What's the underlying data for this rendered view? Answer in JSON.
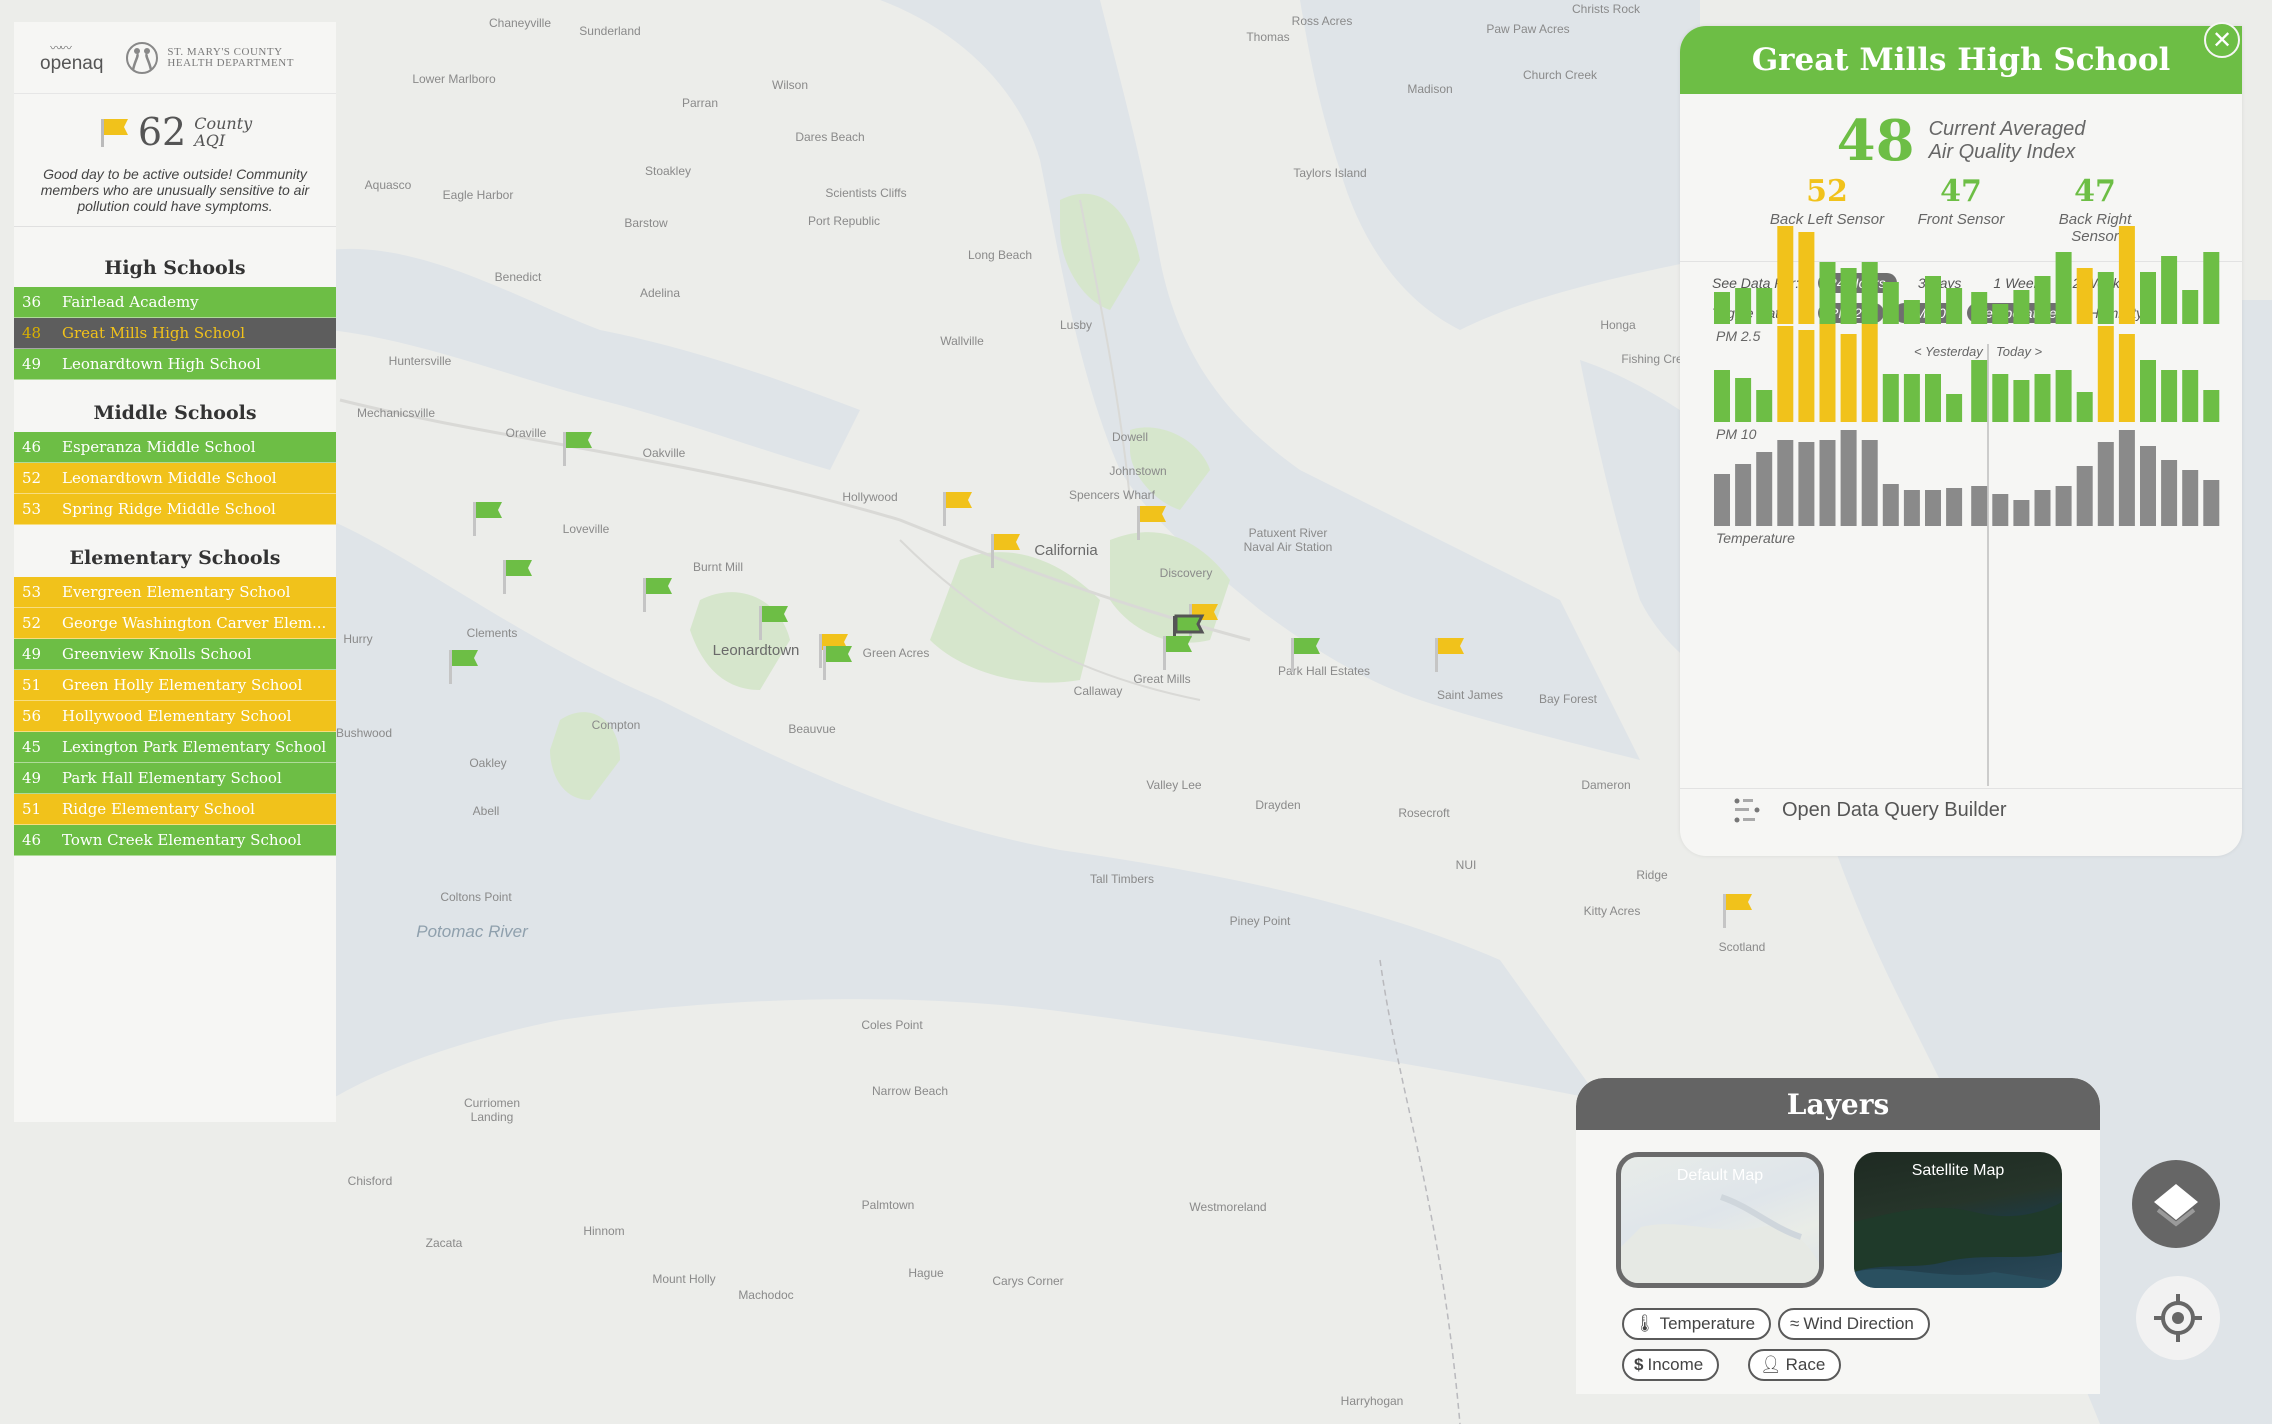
{
  "colors": {
    "green": "#6dbe45",
    "yellow": "#f1c21b",
    "selected": "#5d5d5d",
    "panel": "#f6f6f4",
    "grey_bar": "#8a8a8a"
  },
  "logos": {
    "openaq": "openaq",
    "health_dept_line1": "ST. MARY'S COUNTY",
    "health_dept_line2": "HEALTH DEPARTMENT"
  },
  "county": {
    "aqi": "62",
    "label_line1": "County",
    "label_line2": "AQI",
    "message": "Good day to be active outside! Community members who are unusually sensitive to air pollution could have symptoms."
  },
  "groups": [
    {
      "title": "High Schools",
      "items": [
        {
          "aqi": "36",
          "name": "Fairlead Academy",
          "level": "green"
        },
        {
          "aqi": "48",
          "name": "Great Mills High School",
          "level": "selected"
        },
        {
          "aqi": "49",
          "name": "Leonardtown High School",
          "level": "green"
        }
      ]
    },
    {
      "title": "Middle Schools",
      "items": [
        {
          "aqi": "46",
          "name": "Esperanza Middle School",
          "level": "green"
        },
        {
          "aqi": "52",
          "name": "Leonardtown Middle School",
          "level": "yellow"
        },
        {
          "aqi": "53",
          "name": "Spring Ridge Middle School",
          "level": "yellow"
        }
      ]
    },
    {
      "title": "Elementary Schools",
      "items": [
        {
          "aqi": "53",
          "name": "Evergreen Elementary School",
          "level": "yellow"
        },
        {
          "aqi": "52",
          "name": "George Washington Carver Elem...",
          "level": "yellow"
        },
        {
          "aqi": "49",
          "name": "Greenview Knolls School",
          "level": "green"
        },
        {
          "aqi": "51",
          "name": "Green Holly Elementary School",
          "level": "yellow"
        },
        {
          "aqi": "56",
          "name": "Hollywood Elementary School",
          "level": "yellow"
        },
        {
          "aqi": "45",
          "name": "Lexington Park Elementary School",
          "level": "green"
        },
        {
          "aqi": "49",
          "name": "Park Hall Elementary School",
          "level": "green"
        },
        {
          "aqi": "51",
          "name": "Ridge Elementary School",
          "level": "yellow"
        },
        {
          "aqi": "46",
          "name": "Town Creek Elementary School",
          "level": "green"
        }
      ]
    }
  ],
  "detail": {
    "title": "Great Mills High School",
    "close_icon": "close-icon",
    "aqi": "48",
    "aqi_label_line1": "Current Averaged",
    "aqi_label_line2": "Air Quality Index",
    "sensors": [
      {
        "value": "52",
        "label": "Back Left Sensor",
        "color": "#f1c21b"
      },
      {
        "value": "47",
        "label": "Front Sensor",
        "color": "#6dbe45"
      },
      {
        "value": "47",
        "label": "Back Right Sensor",
        "color": "#6dbe45"
      }
    ],
    "see_data_label": "See Data For:",
    "ranges": [
      {
        "label": "24 Hours",
        "active": true
      },
      {
        "label": "3 Days",
        "active": false
      },
      {
        "label": "1 Week",
        "active": false
      },
      {
        "label": "2 Weeks",
        "active": false
      }
    ],
    "toggle_label": "Toggle Data:",
    "toggles": [
      {
        "label": "PM 2.5",
        "active": true
      },
      {
        "label": "PM 10",
        "active": true
      },
      {
        "label": "Temperature",
        "active": true
      },
      {
        "label": "Humidity",
        "active": false
      }
    ],
    "yesterday_label": "< Yesterday",
    "today_label": "Today >",
    "query_label": "Open Data Query Builder",
    "query_icon": "query-builder-icon"
  },
  "chart_data": [
    {
      "type": "bar",
      "title": "PM 2.5",
      "values": [
        0.32,
        0.36,
        0.36,
        0.98,
        0.92,
        0.62,
        0.56,
        0.62,
        0.42,
        0.24,
        0.48,
        0.36,
        0.32,
        0.2,
        0.34,
        0.48,
        0.72,
        0.56,
        0.52,
        0.98,
        0.52,
        0.68,
        0.34,
        0.72
      ],
      "levels": [
        "g",
        "g",
        "g",
        "y",
        "y",
        "g",
        "g",
        "g",
        "g",
        "g",
        "g",
        "g",
        "g",
        "g",
        "g",
        "g",
        "g",
        "y",
        "g",
        "y",
        "g",
        "g",
        "g",
        "g"
      ]
    },
    {
      "type": "bar",
      "title": "PM 10",
      "values": [
        0.52,
        0.44,
        0.32,
        0.96,
        0.92,
        0.98,
        0.88,
        0.98,
        0.48,
        0.48,
        0.48,
        0.28,
        0.62,
        0.48,
        0.42,
        0.48,
        0.52,
        0.3,
        0.96,
        0.88,
        0.62,
        0.52,
        0.52,
        0.32
      ],
      "levels": [
        "g",
        "g",
        "g",
        "y",
        "y",
        "y",
        "y",
        "y",
        "g",
        "g",
        "g",
        "g",
        "g",
        "g",
        "g",
        "g",
        "g",
        "g",
        "y",
        "y",
        "g",
        "g",
        "g",
        "g"
      ]
    },
    {
      "type": "bar",
      "title": "Temperature",
      "values": [
        0.52,
        0.62,
        0.74,
        0.86,
        0.84,
        0.86,
        0.96,
        0.86,
        0.42,
        0.36,
        0.36,
        0.38,
        0.4,
        0.32,
        0.26,
        0.36,
        0.4,
        0.6,
        0.84,
        0.96,
        0.8,
        0.66,
        0.56,
        0.46
      ],
      "levels": [
        "n",
        "n",
        "n",
        "n",
        "n",
        "n",
        "n",
        "n",
        "n",
        "n",
        "n",
        "n",
        "n",
        "n",
        "n",
        "n",
        "n",
        "n",
        "n",
        "n",
        "n",
        "n",
        "n",
        "n"
      ]
    }
  ],
  "map": {
    "river_label": "Potomac River",
    "places": [
      "Chaneyville",
      "Sunderland",
      "Lower Marlboro",
      "Parran",
      "Wilson",
      "Dares Beach",
      "Stoakley",
      "Scientists Cliffs",
      "Port Republic",
      "Barstow",
      "Aquasco",
      "Eagle Harbor",
      "Benedict",
      "Adelina",
      "Huntersville",
      "Mechanicsville",
      "Oraville",
      "Oakville",
      "Hollywood",
      "Loveville",
      "Spencers Wharf",
      "California",
      "Burnt Mill",
      "Clements",
      "Leonardtown",
      "Green Acres",
      "Hurry",
      "Compton",
      "Beauvue",
      "Callaway",
      "Great Mills",
      "Park Hall Estates",
      "Saint James",
      "Bay Forest",
      "Oakley",
      "Abell",
      "Valley Lee",
      "Drayden",
      "Rosecroft",
      "Dameron",
      "Ridge",
      "Kitty Acres",
      "Scotland",
      "Tall Timbers",
      "Piney Point",
      "Coltons Point",
      "Coles Point",
      "Narrow Beach",
      "Curriomen Landing",
      "Chisford",
      "Palmtown",
      "Westmoreland",
      "Zacata",
      "Hinnom",
      "Mount Holly",
      "Machodoc",
      "Hague",
      "Carys Corner",
      "Harryhogan",
      "Lusby",
      "Wallville",
      "Long Beach",
      "Dowell",
      "Johnstown",
      "Patuxent River Naval Air Station",
      "Discovery",
      "Taylors Island",
      "Madison",
      "Church Creek",
      "Thomas",
      "Ross Acres",
      "Paw Paw Acres",
      "Honga",
      "Fishing Cre",
      "Bushwood",
      "NUI",
      "Christs Rock"
    ]
  },
  "layers": {
    "title": "Layers",
    "maps": [
      {
        "label": "Default Map",
        "active": true
      },
      {
        "label": "Satellite Map",
        "active": false
      }
    ],
    "chips": [
      {
        "label": "Temperature",
        "icon": "thermometer-icon"
      },
      {
        "label": "Wind Direction",
        "icon": "wind-icon"
      },
      {
        "label": "Income",
        "icon": "dollar-icon"
      },
      {
        "label": "Race",
        "icon": "person-icon"
      }
    ]
  },
  "fabs": {
    "layers_icon": "layers-icon",
    "locate_icon": "locate-icon"
  }
}
